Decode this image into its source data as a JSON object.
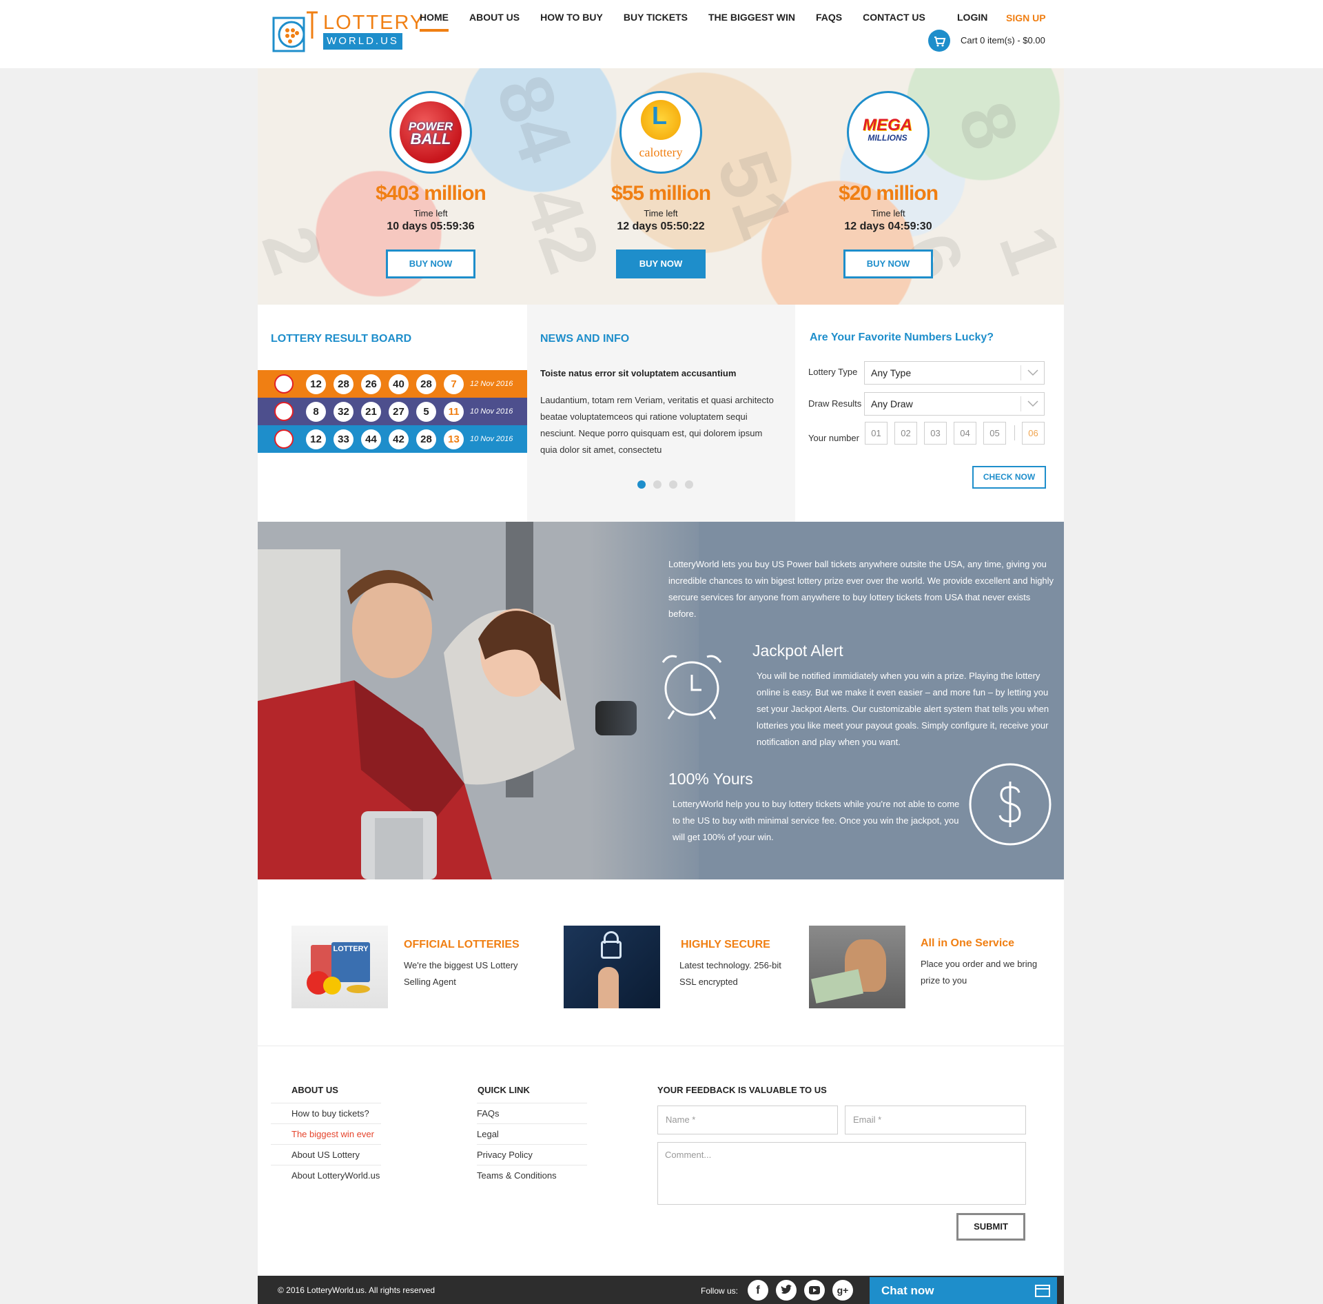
{
  "header": {
    "logo_line1": "LOTTERY",
    "logo_line2": "WORLD.US",
    "nav": [
      "HOME",
      "ABOUT US",
      "HOW TO BUY",
      "BUY TICKETS",
      "THE BIGGEST WIN",
      "FAQS",
      "CONTACT US"
    ],
    "login": "LOGIN",
    "signup": "SIGN UP",
    "cart": "Cart 0 item(s) - $0.00",
    "cart_icon": "shopping-cart-icon"
  },
  "hero": {
    "lotteries": [
      {
        "logo_text1": "POWER",
        "logo_text2": "BALL",
        "jackpot": "$403 million",
        "time_label": "Time left",
        "countdown": "10 days 05:59:36",
        "button": "BUY NOW"
      },
      {
        "logo_text1": "L",
        "logo_text2": "calottery",
        "jackpot": "$55 million",
        "time_label": "Time left",
        "countdown": "12 days 05:50:22",
        "button": "BUY NOW"
      },
      {
        "logo_text1": "MEGA",
        "logo_text2": "MILLIONS",
        "jackpot": "$20 million",
        "time_label": "Time left",
        "countdown": "12 days 04:59:30",
        "button": "BUY NOW"
      }
    ],
    "background_numbers": [
      "84",
      "42",
      "51",
      "8",
      "2",
      "1",
      "6"
    ]
  },
  "results": {
    "title": "LOTTERY RESULT BOARD",
    "rows": [
      {
        "color": "#f07f13",
        "numbers": [
          "12",
          "28",
          "26",
          "40",
          "28"
        ],
        "bonus": "7",
        "date": "12 Nov 2016"
      },
      {
        "color": "#4d4f8d",
        "numbers": [
          "8",
          "32",
          "21",
          "27",
          "5"
        ],
        "bonus": "11",
        "date": "10 Nov 2016"
      },
      {
        "color": "#1e8ecb",
        "numbers": [
          "12",
          "33",
          "44",
          "42",
          "28"
        ],
        "bonus": "13",
        "date": "10 Nov 2016"
      }
    ]
  },
  "news": {
    "title": "NEWS AND INFO",
    "headline": "Toiste natus error sit voluptatem accusantium",
    "body": "Laudantium, totam rem Veriam,  veritatis et quasi architecto beatae voluptatemceos qui ratione voluptatem sequi nesciunt. Neque porro quisquam est, qui dolorem ipsum quia dolor sit amet, consectetu"
  },
  "lucky": {
    "title": "Are Your Favorite Numbers Lucky?",
    "type_label": "Lottery Type",
    "type_value": "Any Type",
    "draw_label": "Draw Results",
    "draw_value": "Any Draw",
    "number_label": "Your number",
    "numbers": [
      "01",
      "02",
      "03",
      "04",
      "05",
      "06"
    ],
    "button": "CHECK NOW"
  },
  "feature": {
    "intro": "LotteryWorld lets you buy US Power ball tickets anywhere outsite the USA, any time, giving you incredible chances to win bigest lottery prize ever over the world. We provide excellent and highly sercure services for anyone from anywhere to buy lottery tickets from USA that never exists before.",
    "jackpot_title": "Jackpot Alert",
    "jackpot_text": "You will be notified immidiately when you win a prize. Playing the lottery online is easy. But we make it even easier – and more fun – by letting you set your Jackpot Alerts. Our customizable alert system that tells you when lotteries you like meet your payout goals. Simply configure it, receive your notification and play when you want.",
    "yours_title": "100% Yours",
    "yours_text": "LotteryWorld help you to buy lottery tickets while you're not able to come to the US to buy with minimal service fee. Once you win the jackpot, you will get 100% of your win."
  },
  "services": [
    {
      "title": "OFFICIAL LOTTERIES",
      "text": "We're the biggest US Lottery Selling Agent",
      "image_text": "LOTTERY"
    },
    {
      "title": "HIGHLY SECURE",
      "text": "Latest technology. 256-bit SSL encrypted"
    },
    {
      "title": "All in One Service",
      "text": "Place you order and we bring prize to you"
    }
  ],
  "footer": {
    "about_title": "ABOUT US",
    "about_links": [
      "How to buy tickets?",
      "The biggest win ever",
      "About US Lottery",
      "About LotteryWorld.us"
    ],
    "quick_title": "QUICK LINK",
    "quick_links": [
      "FAQs",
      "Legal",
      "Privacy Policy",
      "Teams & Conditions"
    ],
    "feedback_title": "YOUR FEEDBACK IS VALUABLE TO US",
    "name_placeholder": "Name *",
    "email_placeholder": "Email *",
    "comment_placeholder": "Comment...",
    "submit": "SUBMIT",
    "copyright": "© 2016 LotteryWorld.us. All rights reserved",
    "follow": "Follow us:",
    "chat": "Chat now"
  },
  "colors": {
    "accent_orange": "#f07f13",
    "accent_blue": "#1e8ecb",
    "feature_bg": "#7d8ea1"
  }
}
